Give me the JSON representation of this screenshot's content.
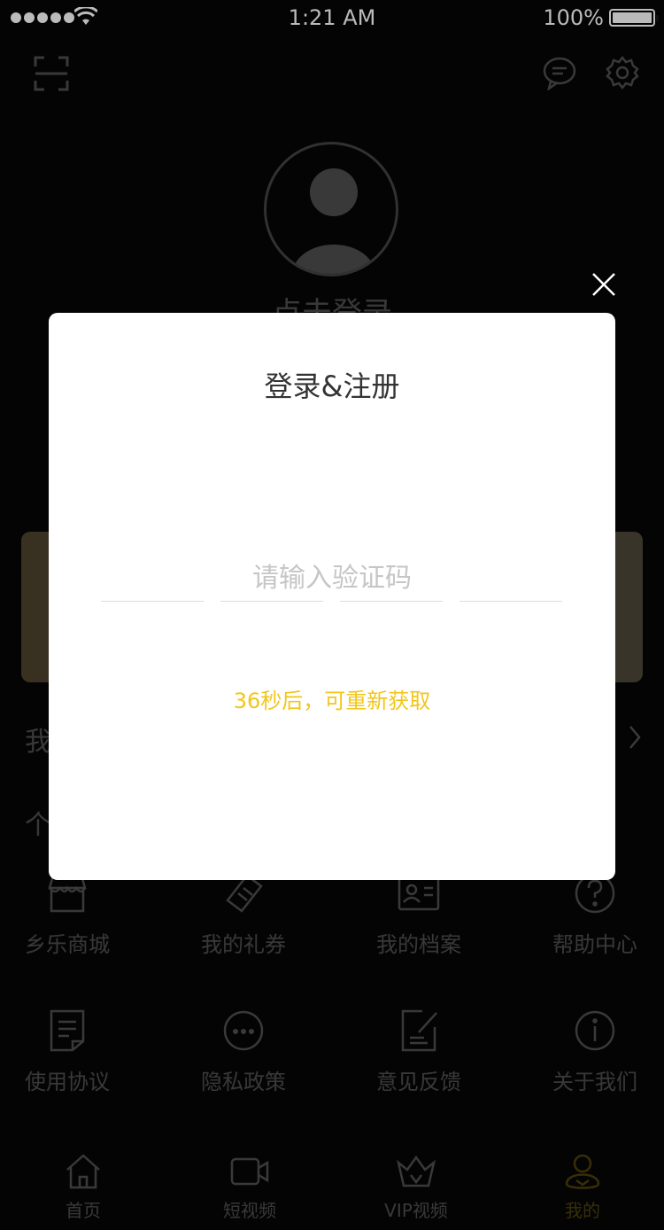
{
  "status_bar": {
    "time": "1:21 AM",
    "battery_percent": "100%"
  },
  "profile": {
    "login_prompt": "点击登录"
  },
  "sections": {
    "my_label": "我",
    "personal_label": "个"
  },
  "services": [
    {
      "label": "乡乐商城",
      "icon": "store-icon"
    },
    {
      "label": "我的礼券",
      "icon": "ticket-icon"
    },
    {
      "label": "我的档案",
      "icon": "profile-card-icon"
    },
    {
      "label": "帮助中心",
      "icon": "help-icon"
    },
    {
      "label": "使用协议",
      "icon": "document-icon"
    },
    {
      "label": "隐私政策",
      "icon": "more-dots-icon"
    },
    {
      "label": "意见反馈",
      "icon": "edit-note-icon"
    },
    {
      "label": "关于我们",
      "icon": "info-icon"
    }
  ],
  "tabbar": {
    "tabs": [
      {
        "label": "首页",
        "icon": "home-icon"
      },
      {
        "label": "短视频",
        "icon": "video-icon"
      },
      {
        "label": "VIP视频",
        "icon": "crown-icon"
      },
      {
        "label": "我的",
        "icon": "user-icon"
      }
    ],
    "active_index": 3
  },
  "modal": {
    "title": "登录&注册",
    "code_placeholder": "请输入验证码",
    "code_length": 4,
    "resend_text": "36秒后，可重新获取"
  },
  "colors": {
    "accent": "#f2c61b",
    "overlay": "#000000",
    "modal_bg": "#ffffff"
  }
}
